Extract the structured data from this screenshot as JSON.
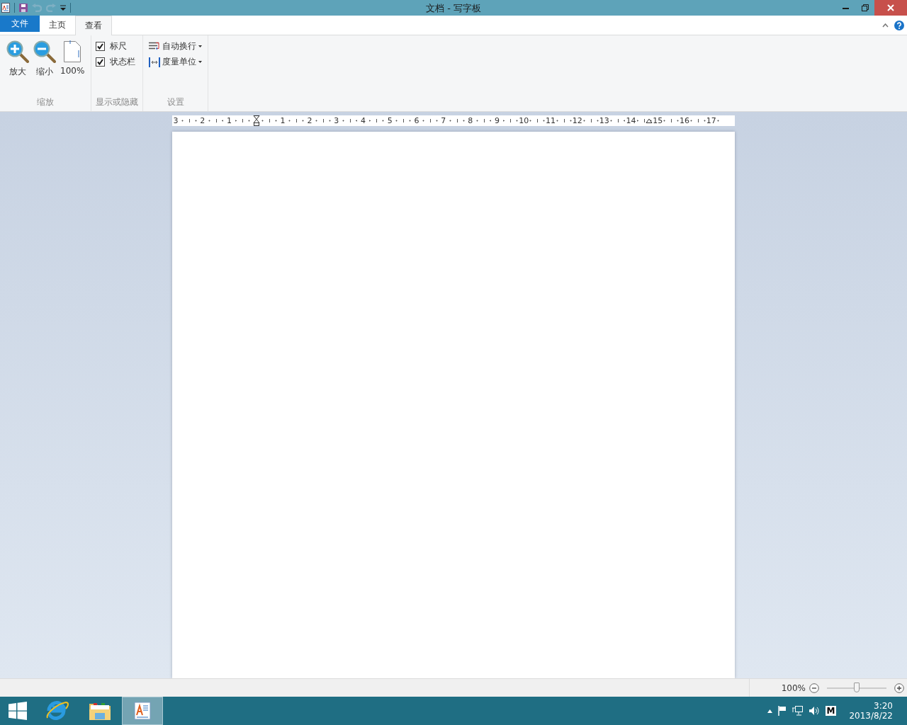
{
  "window": {
    "title": "文档 - 写字板"
  },
  "tabs": [
    {
      "label": "文件",
      "kind": "file",
      "selected": false
    },
    {
      "label": "主页",
      "kind": "tab",
      "selected": false
    },
    {
      "label": "查看",
      "kind": "tab",
      "selected": true
    }
  ],
  "ribbon": {
    "groups": [
      {
        "label": "缩放",
        "kind": "buttons",
        "items": [
          {
            "label": "放大"
          },
          {
            "label": "缩小"
          },
          {
            "label": "100%"
          }
        ]
      },
      {
        "label": "显示或隐藏",
        "kind": "checkboxes",
        "items": [
          {
            "label": "标尺",
            "checked": true
          },
          {
            "label": "状态栏",
            "checked": true
          }
        ]
      },
      {
        "label": "设置",
        "kind": "dropdowns",
        "items": [
          {
            "label": "自动换行"
          },
          {
            "label": "度量单位"
          }
        ]
      }
    ]
  },
  "ruler": {
    "left_labels": [
      "3",
      "2",
      "1"
    ],
    "labels": [
      "1",
      "2",
      "3",
      "4",
      "5",
      "6",
      "7",
      "8",
      "9",
      "10",
      "11",
      "12",
      "13",
      "14",
      "15",
      "16",
      "17"
    ]
  },
  "status_bar": {
    "zoom": "100%",
    "level": 0.5
  },
  "taskbar": {
    "apps": [
      {
        "selected": false
      },
      {
        "selected": false
      },
      {
        "selected": true
      }
    ],
    "ime": "M",
    "time": "3:20",
    "date": "2013/8/22"
  }
}
